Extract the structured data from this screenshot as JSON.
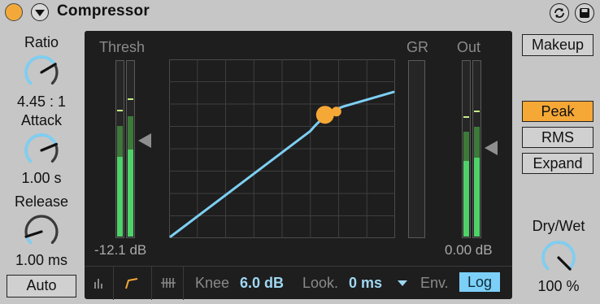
{
  "device": {
    "title": "Compressor",
    "accent_color": "#f6a836",
    "curve_color": "#7dcff3",
    "meter_color": "#4ed269",
    "icons": {
      "power": "power-toggle-icon",
      "fold": "fold-arrow-icon",
      "sync": "sync-icon",
      "save": "save-icon"
    }
  },
  "left_panel": {
    "ratio": {
      "label": "Ratio",
      "value": "4.45 : 1",
      "knob_level": 0.72
    },
    "attack": {
      "label": "Attack",
      "value": "1.00 s",
      "knob_level": 0.75
    },
    "release": {
      "label": "Release",
      "value": "1.00 ms",
      "knob_level": 0.1
    },
    "auto_label": "Auto"
  },
  "display": {
    "thresh_label": "Thresh",
    "gr_label": "GR",
    "out_label": "Out",
    "thresh_value": "-12.1 dB",
    "out_value": "0.00 dB",
    "thresh_level": 0.69,
    "out_level": 0.6,
    "gr_level": 0
  },
  "bottom_bar": {
    "view_icons": [
      "meter-view-icon",
      "curve-view-icon",
      "activity-view-icon"
    ],
    "knee_label": "Knee",
    "knee_value": "6.0 dB",
    "look_label": "Look.",
    "look_value": "0 ms",
    "env_label": "Env.",
    "env_value": "Log"
  },
  "right_panel": {
    "makeup_label": "Makeup",
    "peak_label": "Peak",
    "rms_label": "RMS",
    "expand_label": "Expand",
    "selected_mode": "Peak",
    "drywet_label": "Dry/Wet",
    "drywet_value": "100 %",
    "drywet_level": 1.0
  }
}
